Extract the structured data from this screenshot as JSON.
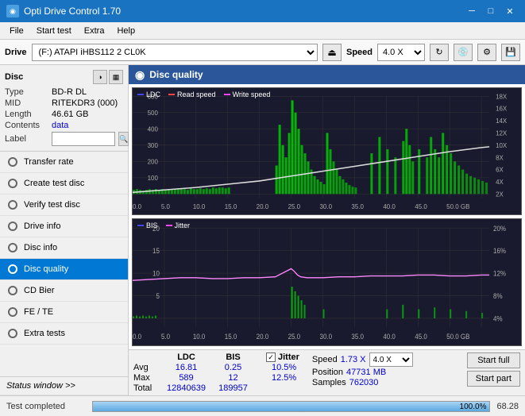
{
  "titlebar": {
    "title": "Opti Drive Control 1.70",
    "min_label": "─",
    "max_label": "□",
    "close_label": "✕"
  },
  "menubar": {
    "items": [
      "File",
      "Start test",
      "Extra",
      "Help"
    ]
  },
  "drivebar": {
    "label": "Drive",
    "drive_value": "(F:)  ATAPI iHBS112   2 CL0K",
    "speed_label": "Speed",
    "speed_value": "4.0 X"
  },
  "disc_panel": {
    "title": "Disc",
    "type_label": "Type",
    "type_value": "BD-R DL",
    "mid_label": "MID",
    "mid_value": "RITEKDR3 (000)",
    "length_label": "Length",
    "length_value": "46.61 GB",
    "contents_label": "Contents",
    "contents_value": "data",
    "label_label": "Label"
  },
  "nav": {
    "items": [
      {
        "id": "transfer-rate",
        "label": "Transfer rate",
        "active": false
      },
      {
        "id": "create-test-disc",
        "label": "Create test disc",
        "active": false
      },
      {
        "id": "verify-test-disc",
        "label": "Verify test disc",
        "active": false
      },
      {
        "id": "drive-info",
        "label": "Drive info",
        "active": false
      },
      {
        "id": "disc-info",
        "label": "Disc info",
        "active": false
      },
      {
        "id": "disc-quality",
        "label": "Disc quality",
        "active": true
      },
      {
        "id": "cd-bier",
        "label": "CD Bier",
        "active": false
      },
      {
        "id": "fe-te",
        "label": "FE / TE",
        "active": false
      },
      {
        "id": "extra-tests",
        "label": "Extra tests",
        "active": false
      }
    ],
    "status_window": "Status window >>"
  },
  "content": {
    "header": "Disc quality"
  },
  "chart1": {
    "legend": [
      {
        "id": "ldc",
        "label": "LDC"
      },
      {
        "id": "read",
        "label": "Read speed"
      },
      {
        "id": "write",
        "label": "Write speed"
      }
    ],
    "y_max": 600,
    "y_axis_right": [
      "18X",
      "16X",
      "14X",
      "12X",
      "10X",
      "8X",
      "6X",
      "4X",
      "2X"
    ],
    "x_axis": [
      "0.0",
      "5.0",
      "10.0",
      "15.0",
      "20.0",
      "25.0",
      "30.0",
      "35.0",
      "40.0",
      "45.0",
      "50.0 GB"
    ]
  },
  "chart2": {
    "legend": [
      {
        "id": "bis",
        "label": "BIS"
      },
      {
        "id": "jitter",
        "label": "Jitter"
      }
    ],
    "y_axis": [
      "20",
      "15",
      "10",
      "5"
    ],
    "y_axis_right": [
      "20%",
      "16%",
      "12%",
      "8%",
      "4%"
    ],
    "x_axis": [
      "0.0",
      "5.0",
      "10.0",
      "15.0",
      "20.0",
      "25.0",
      "30.0",
      "35.0",
      "40.0",
      "45.0",
      "50.0 GB"
    ]
  },
  "stats": {
    "ldc_label": "LDC",
    "bis_label": "BIS",
    "jitter_label": "Jitter",
    "avg_label": "Avg",
    "max_label": "Max",
    "total_label": "Total",
    "ldc_avg": "16.81",
    "ldc_max": "589",
    "ldc_total": "12840639",
    "bis_avg": "0.25",
    "bis_max": "12",
    "bis_total": "189957",
    "jitter_avg": "10.5%",
    "jitter_max": "12.5%",
    "speed_label": "Speed",
    "speed_value": "1.73 X",
    "speed_selector": "4.0 X",
    "position_label": "Position",
    "position_value": "47731 MB",
    "samples_label": "Samples",
    "samples_value": "762030",
    "start_full": "Start full",
    "start_part": "Start part"
  },
  "bottombar": {
    "status": "Test completed",
    "progress": "100.0%",
    "version": "68.28"
  }
}
